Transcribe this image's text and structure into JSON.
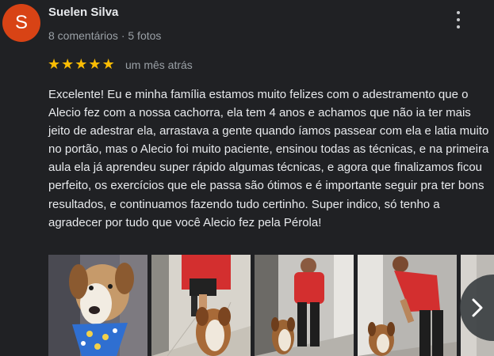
{
  "review": {
    "author_initial": "S",
    "author_name": "Suelen Silva",
    "author_meta": "8 comentários · 5 fotos",
    "rating": 5,
    "stars": [
      "★",
      "★",
      "★",
      "★",
      "★"
    ],
    "date": "um mês atrás",
    "text": "Excelente! Eu e minha família estamos muito felizes com o adestramento que o Alecio fez com a nossa cachorra, ela tem 4 anos e achamos que não ia ter mais jeito de adestrar ela, arrastava a gente quando íamos passear com ela e latia muito no portão, mas o Alecio foi muito paciente, ensinou todas as técnicas, e na primeira aula ela já aprendeu super rápido algumas técnicas, e agora que finalizamos ficou perfeito, os exercícios que ele passa são ótimos e é importante seguir pra ter bons resultados, e continuamos fazendo tudo certinho. Super indico, só tenho a agradecer por tudo que você Alecio fez pela Pérola!"
  },
  "colors": {
    "background": "#202124",
    "avatar": "#d84315",
    "star": "#fbbc04",
    "accent_red_shirt": "#d32f2f"
  },
  "icons": {
    "more": "more-vert-icon",
    "next": "chevron-right-icon"
  },
  "photos": [
    {
      "name": "photo-dog-bandana"
    },
    {
      "name": "photo-trainer-dog-floor"
    },
    {
      "name": "photo-trainer-standing-dog"
    },
    {
      "name": "photo-trainer-hallway-dog"
    },
    {
      "name": "photo-partial"
    }
  ]
}
